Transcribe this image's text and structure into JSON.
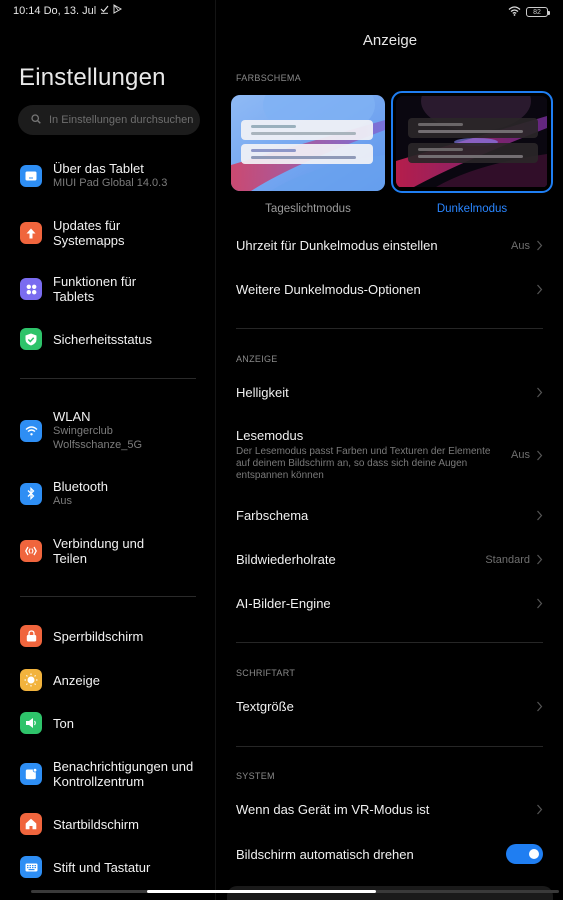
{
  "statusbar": {
    "time_date": "10:14 Do, 13. Jul",
    "battery": "82",
    "icons": [
      "download-done-icon",
      "play-store-icon",
      "wifi-icon",
      "battery-icon"
    ]
  },
  "sidebar": {
    "title": "Einstellungen",
    "search_placeholder": "In Einstellungen durchsuchen",
    "items": [
      {
        "label": "Über das Tablet",
        "sub": "MIUI Pad Global 14.0.3",
        "icon": "tablet-icon",
        "color": "#2e8ef4"
      },
      {
        "label": "Updates für Systemapps",
        "sub": "",
        "icon": "arrow-up-icon",
        "color": "#f0653d"
      },
      {
        "label": "Funktionen für Tablets",
        "sub": "",
        "icon": "grid-icon",
        "color": "#7a6cf0"
      },
      {
        "label": "Sicherheitsstatus",
        "sub": "",
        "icon": "shield-check-icon",
        "color": "#2ec36a"
      },
      {
        "label": "WLAN",
        "sub": "Swingerclub Wolfsschanze_5G",
        "icon": "wifi-icon",
        "color": "#2e8ef4"
      },
      {
        "label": "Bluetooth",
        "sub": "Aus",
        "icon": "bluetooth-icon",
        "color": "#2e8ef4"
      },
      {
        "label": "Verbindung und Teilen",
        "sub": "",
        "icon": "share-connection-icon",
        "color": "#f0653d"
      },
      {
        "label": "Sperrbildschirm",
        "sub": "",
        "icon": "lock-icon",
        "color": "#f0653d"
      },
      {
        "label": "Anzeige",
        "sub": "",
        "icon": "sun-icon",
        "color": "#f2b33d"
      },
      {
        "label": "Ton",
        "sub": "",
        "icon": "speaker-icon",
        "color": "#2ec36a"
      },
      {
        "label": "Benachrichtigungen und Kontrollzentrum",
        "sub": "",
        "icon": "notification-icon",
        "color": "#2e8ef4"
      },
      {
        "label": "Startbildschirm",
        "sub": "",
        "icon": "home-icon",
        "color": "#f0653d"
      },
      {
        "label": "Stift und Tastatur",
        "sub": "",
        "icon": "keyboard-icon",
        "color": "#2e8ef4"
      }
    ]
  },
  "main": {
    "title": "Anzeige",
    "accent": "#1f7ef2",
    "sections": {
      "farbschema": "FARBSCHEMA",
      "anzeige": "ANZEIGE",
      "schriftart": "SCHRIFTART",
      "system": "SYSTEM"
    },
    "themes": {
      "light_label": "Tageslichtmodus",
      "dark_label": "Dunkelmodus",
      "selected": "dark"
    },
    "rows": {
      "dark_time": {
        "label": "Uhrzeit für Dunkelmodus einstellen",
        "value": "Aus"
      },
      "dark_options": {
        "label": "Weitere Dunkelmodus-Optionen",
        "value": ""
      },
      "brightness": {
        "label": "Helligkeit",
        "value": ""
      },
      "reading": {
        "label": "Lesemodus",
        "desc": "Der Lesemodus passt Farben und Texturen der Elemente auf deinem Bildschirm an, so dass sich deine Augen entspannen können",
        "value": "Aus"
      },
      "color_scheme": {
        "label": "Farbschema",
        "value": ""
      },
      "refresh_rate": {
        "label": "Bildwiederholrate",
        "value": "Standard"
      },
      "ai_engine": {
        "label": "AI-Bilder-Engine",
        "value": ""
      },
      "text_size": {
        "label": "Textgröße",
        "value": ""
      },
      "vr_mode": {
        "label": "Wenn das Gerät im VR-Modus ist",
        "value": ""
      },
      "auto_rotate": {
        "label": "Bildschirm automatisch drehen",
        "enabled": true
      }
    }
  }
}
